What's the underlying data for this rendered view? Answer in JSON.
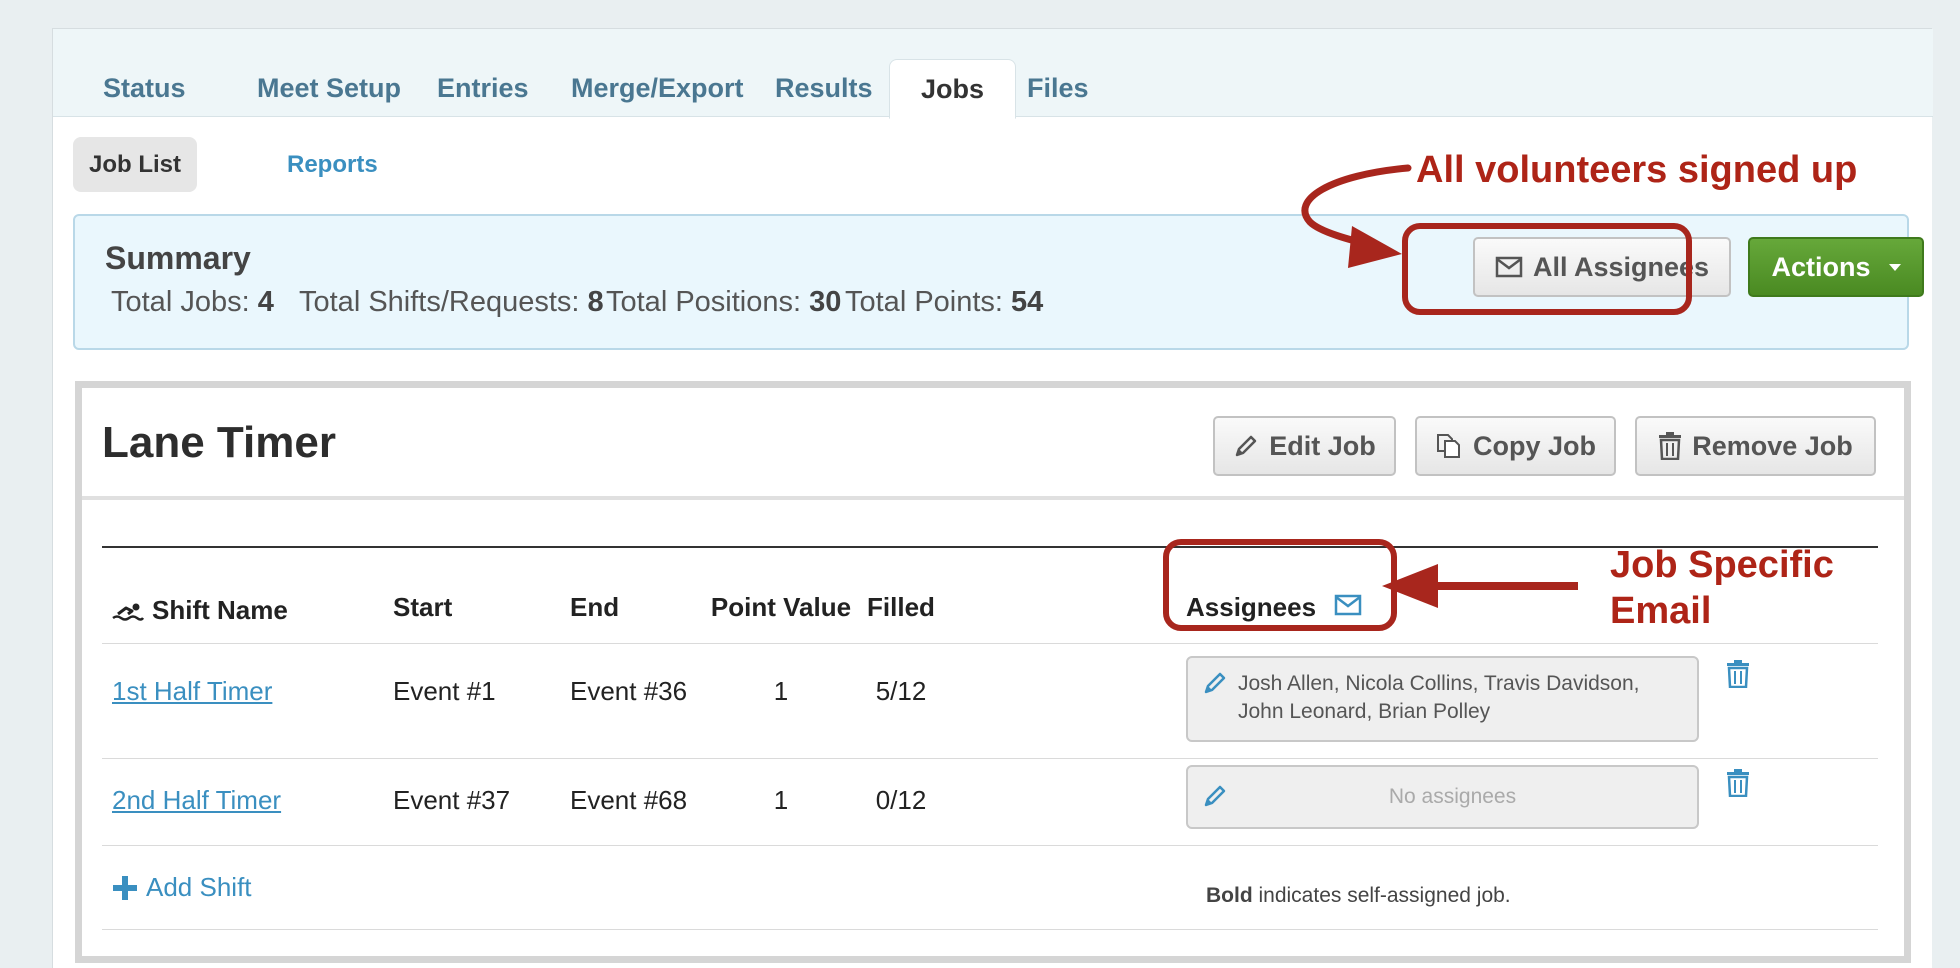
{
  "tabs": [
    {
      "label": "Status"
    },
    {
      "label": "Meet Setup"
    },
    {
      "label": "Entries"
    },
    {
      "label": "Merge/Export"
    },
    {
      "label": "Results"
    },
    {
      "label": "Jobs"
    },
    {
      "label": "Files"
    }
  ],
  "subnav": {
    "job_list": "Job List",
    "reports": "Reports"
  },
  "summary": {
    "title": "Summary",
    "total_jobs_label": "Total Jobs:",
    "total_jobs": "4",
    "total_shifts_label": "Total Shifts/Requests:",
    "total_shifts": "8",
    "total_positions_label": "Total Positions:",
    "total_positions": "30",
    "total_points_label": "Total Points:",
    "total_points": "54",
    "all_assignees_label": "All Assignees",
    "actions_label": "Actions"
  },
  "job": {
    "title": "Lane Timer",
    "edit_label": "Edit Job",
    "copy_label": "Copy Job",
    "remove_label": "Remove Job"
  },
  "table": {
    "headers": {
      "shift_name": "Shift Name",
      "start": "Start",
      "end": "End",
      "point_value": "Point Value",
      "filled": "Filled",
      "assignees": "Assignees"
    },
    "rows": [
      {
        "shift_name": "1st Half Timer",
        "start": "Event #1",
        "end": "Event #36",
        "point_value": "1",
        "filled": "5/12",
        "assignees": "Josh Allen, Nicola Collins, Travis Davidson, John Leonard, Brian Polley"
      },
      {
        "shift_name": "2nd Half Timer",
        "start": "Event #37",
        "end": "Event #68",
        "point_value": "1",
        "filled": "0/12",
        "assignees": "No assignees"
      }
    ],
    "add_shift_label": "Add Shift",
    "note_bold": "Bold",
    "note_rest": " indicates self-assigned job."
  },
  "annotations": {
    "all_volunteers": "All volunteers signed up",
    "job_specific_line1": "Job Specific",
    "job_specific_line2": "Email"
  },
  "colors": {
    "annotation": "#a8261d",
    "link": "#3a8fc0",
    "tab_text": "#4a7791",
    "actions_green": "#55962c"
  }
}
